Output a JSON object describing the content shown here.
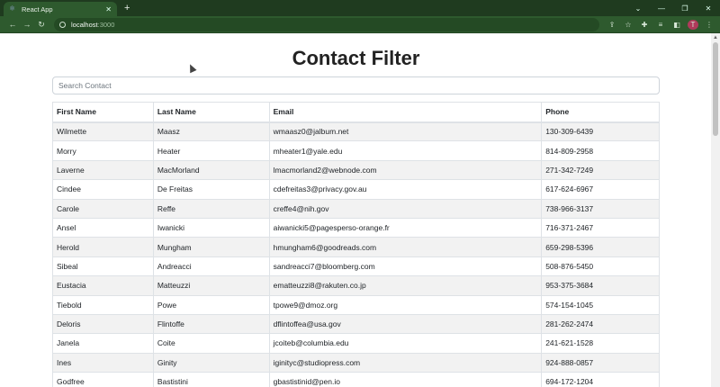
{
  "browser": {
    "tab_title": "React App",
    "tab_icon": "react-icon",
    "new_tab": "+",
    "url_host": "localhost",
    "url_port": ":3000",
    "profile_initial": "T"
  },
  "page": {
    "title": "Contact Filter",
    "search_placeholder": "Search Contact"
  },
  "table": {
    "columns": [
      "First Name",
      "Last Name",
      "Email",
      "Phone"
    ],
    "rows": [
      [
        "Wilmette",
        "Maasz",
        "wmaasz0@jalbum.net",
        "130-309-6439"
      ],
      [
        "Morry",
        "Heater",
        "mheater1@yale.edu",
        "814-809-2958"
      ],
      [
        "Laverne",
        "MacMorland",
        "lmacmorland2@webnode.com",
        "271-342-7249"
      ],
      [
        "Cindee",
        "De Freitas",
        "cdefreitas3@privacy.gov.au",
        "617-624-6967"
      ],
      [
        "Carole",
        "Reffe",
        "creffe4@nih.gov",
        "738-966-3137"
      ],
      [
        "Ansel",
        "Iwanicki",
        "aiwanicki5@pagesperso-orange.fr",
        "716-371-2467"
      ],
      [
        "Herold",
        "Mungham",
        "hmungham6@goodreads.com",
        "659-298-5396"
      ],
      [
        "Sibeal",
        "Andreacci",
        "sandreacci7@bloomberg.com",
        "508-876-5450"
      ],
      [
        "Eustacia",
        "Matteuzzi",
        "ematteuzzi8@rakuten.co.jp",
        "953-375-3684"
      ],
      [
        "Tiebold",
        "Powe",
        "tpowe9@dmoz.org",
        "574-154-1045"
      ],
      [
        "Deloris",
        "Flintoffe",
        "dflintoffea@usa.gov",
        "281-262-2474"
      ],
      [
        "Janela",
        "Coite",
        "jcoiteb@columbia.edu",
        "241-621-1528"
      ],
      [
        "Ines",
        "Ginity",
        "iginityc@studiopress.com",
        "924-888-0857"
      ],
      [
        "Godfree",
        "Bastistini",
        "gbastistinid@pen.io",
        "694-172-1204"
      ]
    ]
  },
  "colors": {
    "chrome_dark": "#1f3b1f",
    "chrome_toolbar": "#2e5a2e",
    "stripe": "#f2f2f2",
    "border": "#dee2e6"
  }
}
